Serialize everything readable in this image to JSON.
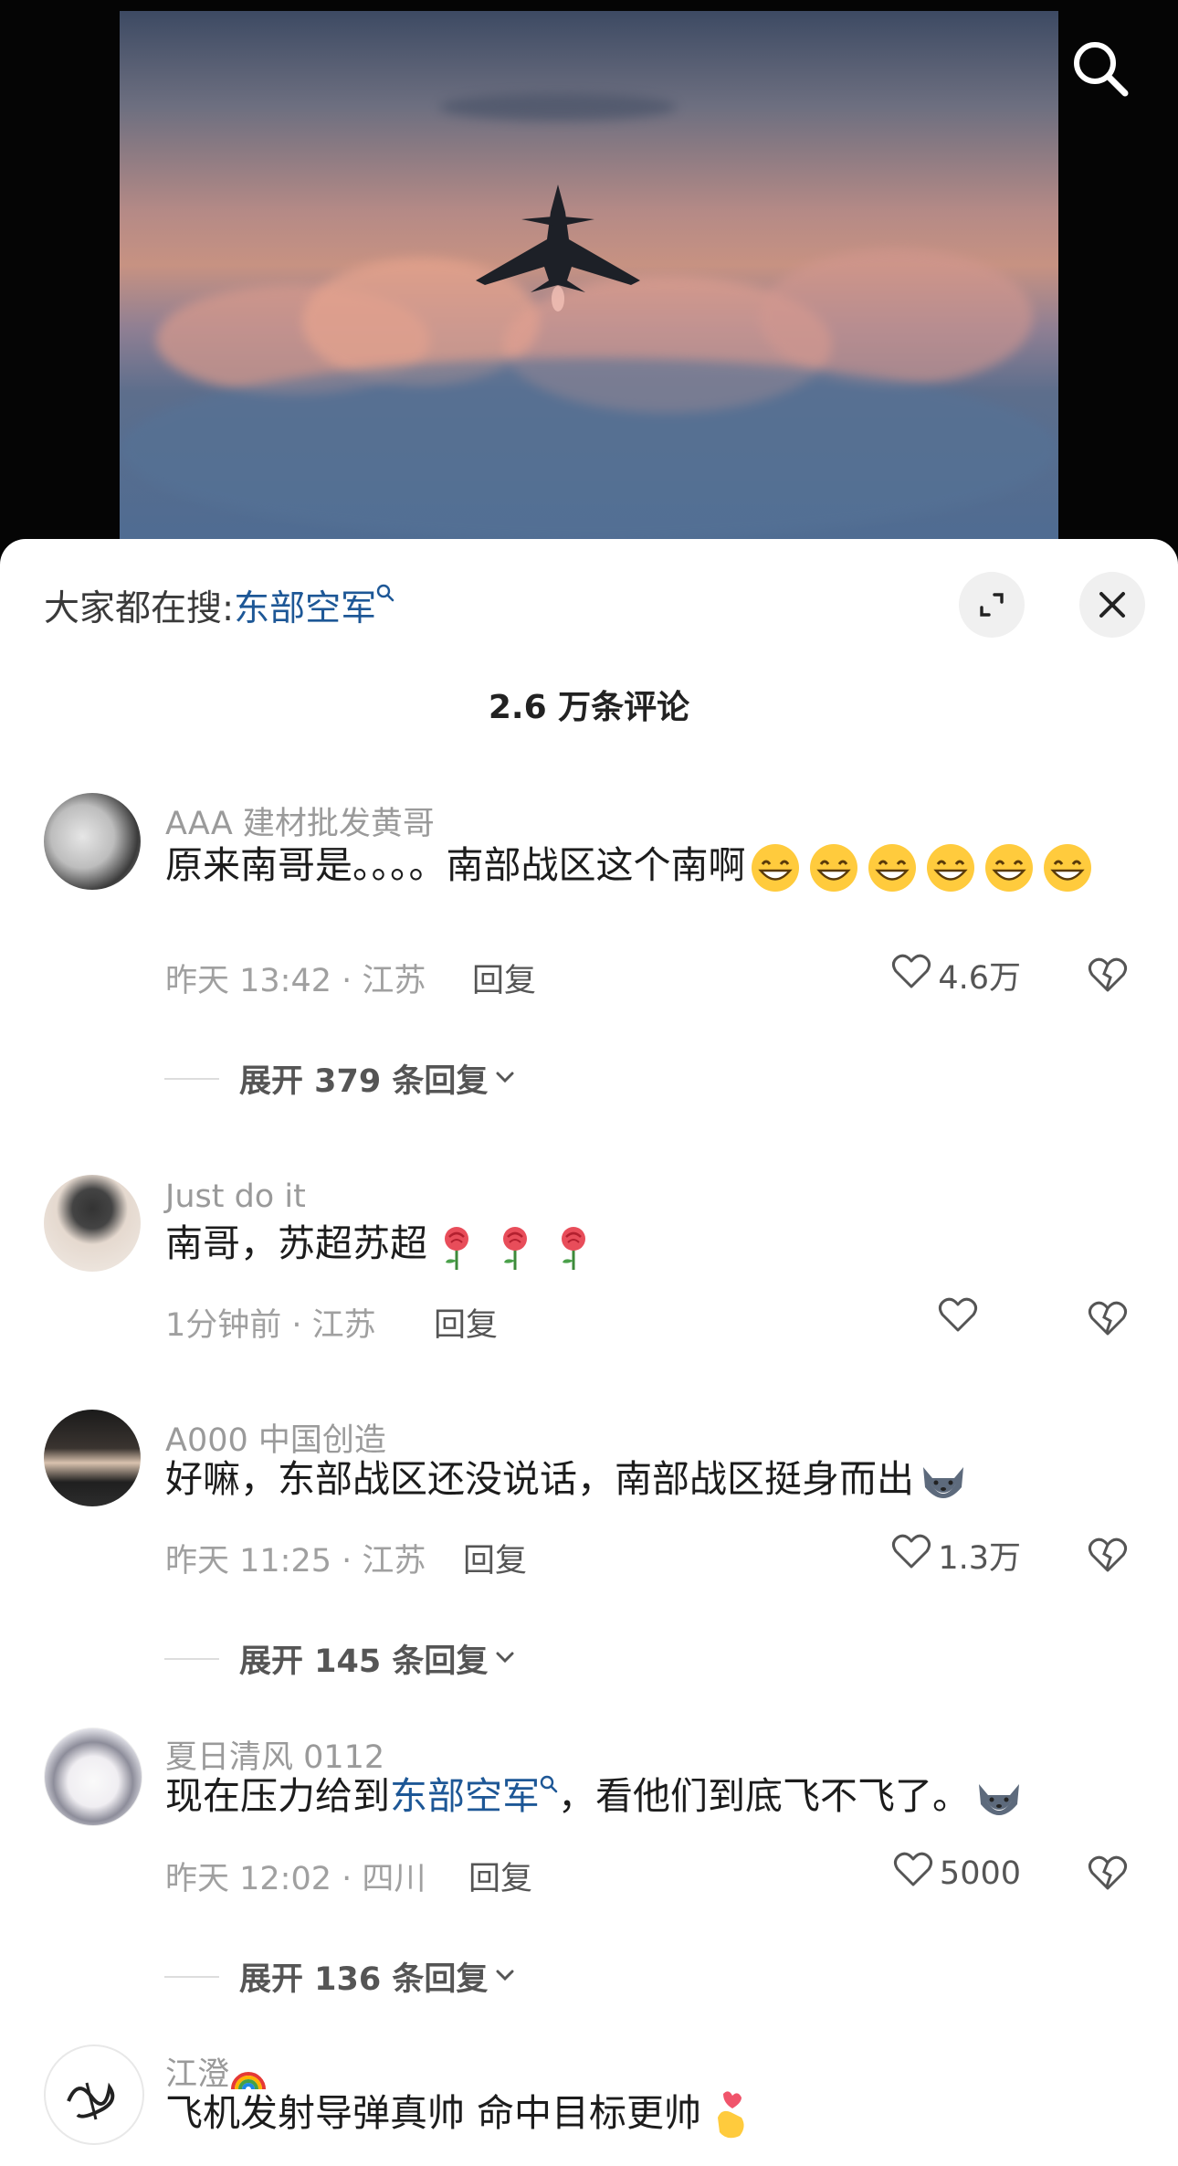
{
  "hot_search": {
    "prefix": "大家都在搜:",
    "keyword": "东部空军"
  },
  "comments_title": "2.6 万条评论",
  "comments": [
    {
      "user": "AAA 建材批发黄哥",
      "text": "原来南哥是。。。。南部战区这个南啊",
      "time": "昨天 13:42 · 江苏",
      "reply": "回复",
      "likes": "4.6万",
      "expand": "展开 379 条回复"
    },
    {
      "user": "Just do it",
      "text": "南哥，苏超苏超",
      "time": "1分钟前 · 江苏",
      "reply": "回复",
      "likes": ""
    },
    {
      "user": "A000 中国创造",
      "text": "好嘛，东部战区还没说话，南部战区挺身而出",
      "time": "昨天 11:25 · 江苏",
      "reply": "回复",
      "likes": "1.3万",
      "expand": "展开 145 条回复"
    },
    {
      "user": "夏日清风 0112",
      "text_before": "现在压力给到",
      "text_kw": "东部空军",
      "text_after": "，看他们到底飞不飞了。",
      "time": "昨天 12:02 · 四川",
      "reply": "回复",
      "likes": "5000",
      "expand": "展开 136 条回复"
    },
    {
      "user": "江澄",
      "text": "飞机发射导弹真帅  命中目标更帅"
    }
  ],
  "colors": {
    "keyword": "#1d5796",
    "meta": "#a0a0a0"
  }
}
